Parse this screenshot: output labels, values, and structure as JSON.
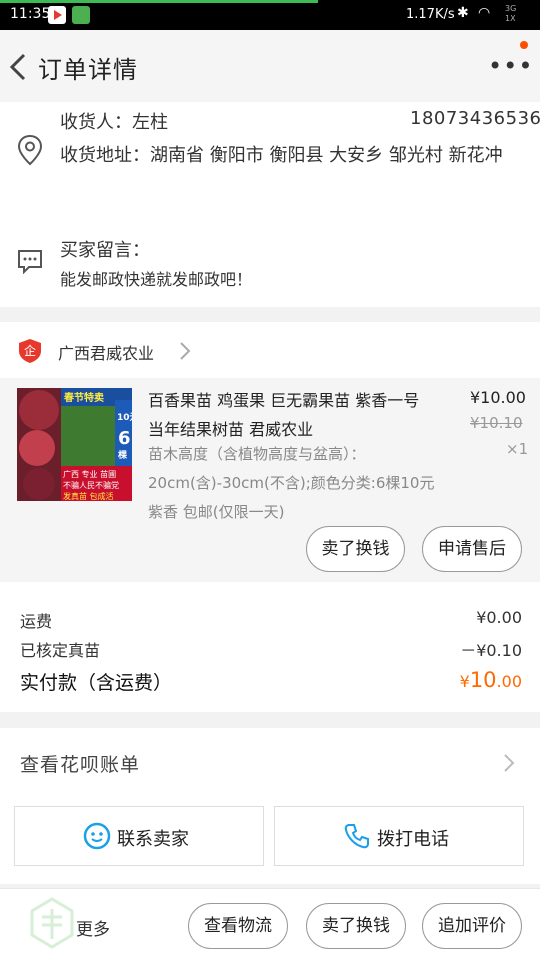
{
  "status_bar": {
    "time": "11:35",
    "net_speed": "1.17K/s",
    "signal_top": "3G",
    "signal_bottom": "1X",
    "icons": [
      "app-store-icon",
      "wechat-icon",
      "bluetooth-icon",
      "wifi-icon",
      "signal-icon"
    ]
  },
  "nav": {
    "title": "订单详情",
    "more_label": "•••",
    "accent": "#ff5000"
  },
  "address": {
    "name": "收货人：左柱",
    "phone": "18073436536",
    "address": "收货地址：湖南省 衡阳市 衡阳县 大安乡 邹光村 新花冲",
    "message_label": "买家留言：",
    "message_text": "能发邮政快递就发邮政吧！"
  },
  "shop": {
    "name": "广西君威农业",
    "logo_char": "企"
  },
  "item": {
    "image_texts": {
      "top": "春节特卖",
      "side_a": "10元",
      "side_b": "6",
      "side_c": "棵",
      "promo_a": "广西 专业 苗圃",
      "promo_b": "不骗人民不骗党",
      "promo_c": "发真苗 包成活"
    },
    "title": "百香果苗 鸡蛋果 巨无霸果苗 紫香一号 当年结果树苗 君威农业",
    "sku": "苗木高度（含植物高度与盆高）：20cm(含)-30cm(不含);颜色分类:6棵10元紫香 包邮(仅限一天)",
    "price": "¥10.00",
    "original_price": "¥10.10",
    "quantity": "×1",
    "buttons": {
      "sell": "卖了换钱",
      "after_sale": "申请售后"
    }
  },
  "summary": {
    "shipping_label": "运费",
    "shipping_value": "¥0.00",
    "discount_label": "已核定真苗",
    "discount_value": "－¥0.10",
    "total_label": "实付款（含运费）",
    "total_currency": "¥",
    "total_int": "10",
    "total_dec": ".00",
    "total_color": "#ff6a00"
  },
  "bill": {
    "label": "查看花呗账单"
  },
  "contact": {
    "seller": "联系卖家",
    "call": "拨打电话",
    "icon_color": "#1aa0e8"
  },
  "bottom": {
    "more": "更多",
    "logistics": "查看物流",
    "sell": "卖了换钱",
    "review": "追加评价"
  }
}
